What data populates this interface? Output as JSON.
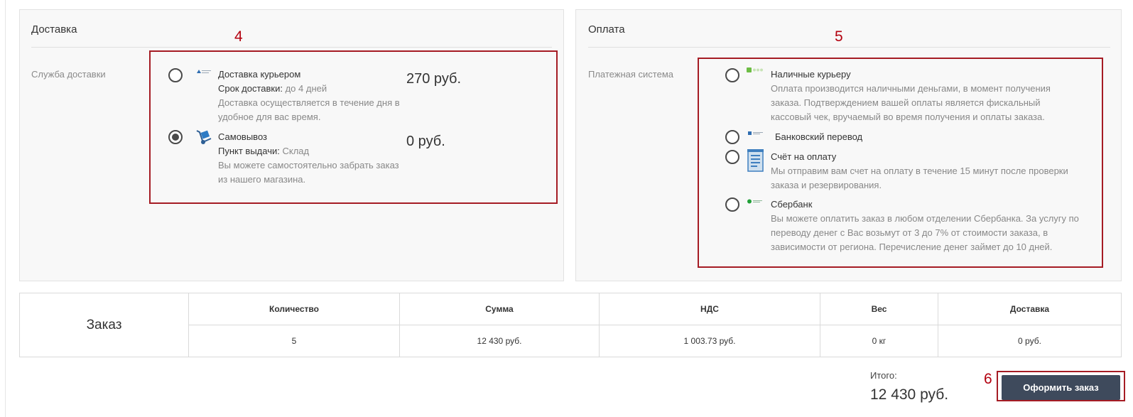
{
  "delivery": {
    "title": "Доставка",
    "service_label": "Служба доставки",
    "annotation": "4",
    "options": [
      {
        "title": "Доставка курьером",
        "term_label": "Срок доставки:",
        "term_value": "до 4 дней",
        "desc_line1": "Доставка осуществляется в течение дня в",
        "desc_line2": "удобное для вас время.",
        "price": "270 руб.",
        "selected": false,
        "icon": "courier-logo-icon"
      },
      {
        "title": "Самовывоз",
        "term_label": "Пункт выдачи:",
        "term_value": "Склад",
        "desc_line1": "Вы можете самостоятельно забрать заказ",
        "desc_line2": "из нашего магазина.",
        "price": "0 руб.",
        "selected": true,
        "icon": "hand-truck-icon"
      }
    ]
  },
  "payment": {
    "title": "Оплата",
    "system_label": "Платежная система",
    "annotation": "5",
    "options": [
      {
        "title": "Наличные курьеру",
        "desc_lines": [
          "Оплата производится наличными деньгами, в момент получения",
          "заказа. Подтверждением вашей оплаты является фискальный",
          "кассовый чек, вручаемый во время получения и оплаты заказа."
        ],
        "icon": "cash-icon"
      },
      {
        "title": "Банковский перевод",
        "desc_lines": [],
        "icon": "bank-transfer-icon"
      },
      {
        "title": "Счёт на оплату",
        "desc_lines": [
          "Мы отправим вам счет на оплату в течение 15 минут после проверки",
          "заказа и резервирования."
        ],
        "icon": "invoice-icon"
      },
      {
        "title": "Сбербанк",
        "desc_lines": [
          "Вы можете оплатить заказ в любом отделении Сбербанка. За услугу по",
          "переводу денег с Вас возьмут от 3 до 7% от стоимости заказа, в",
          "зависимости от региона. Перечисление денег займет до 10 дней."
        ],
        "icon": "sberbank-icon"
      }
    ]
  },
  "order": {
    "title": "Заказ",
    "headers": [
      "Количество",
      "Сумма",
      "НДС",
      "Вес",
      "Доставка"
    ],
    "values": [
      "5",
      "12 430 руб.",
      "1 003.73 руб.",
      "0 кг",
      "0 руб."
    ]
  },
  "summary": {
    "total_label": "Итого:",
    "total_value": "12 430 руб.",
    "checkout_label": "Оформить заказ",
    "annotation": "6"
  },
  "colors": {
    "annotation": "#a51c24",
    "button": "#3e4a5c",
    "panel_bg": "#f8f8f8"
  }
}
